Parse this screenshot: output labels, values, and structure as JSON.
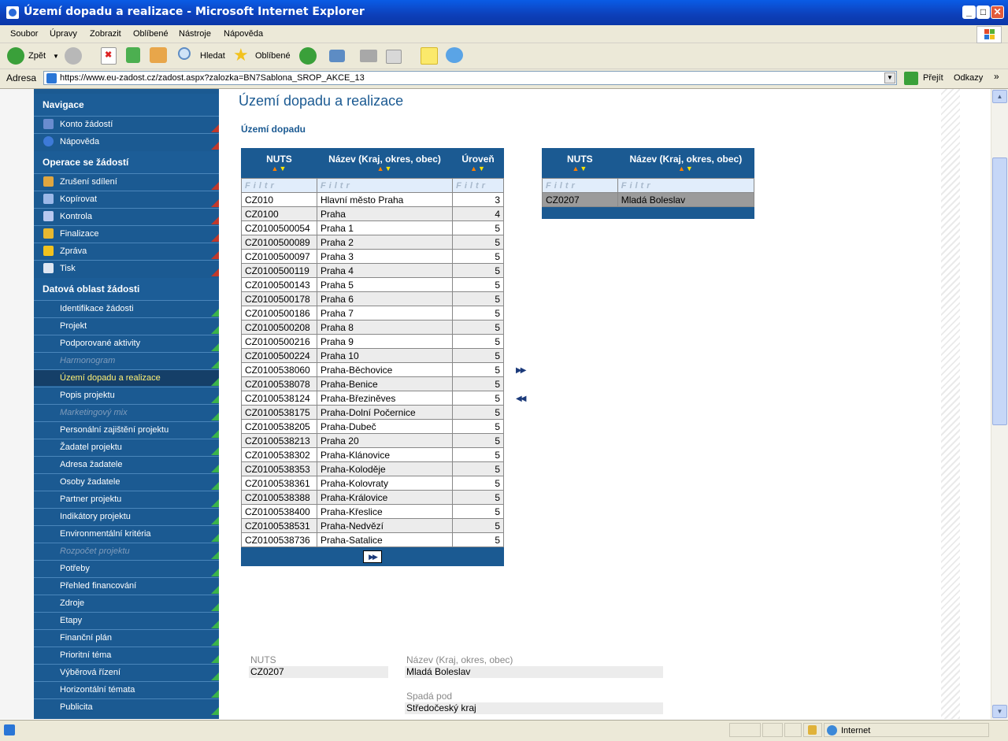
{
  "window": {
    "title": "Území dopadu a realizace - Microsoft Internet Explorer"
  },
  "menu": [
    "Soubor",
    "Úpravy",
    "Zobrazit",
    "Oblíbené",
    "Nástroje",
    "Nápověda"
  ],
  "toolbar": {
    "back": "Zpět",
    "search": "Hledat",
    "favorites": "Oblíbené"
  },
  "address": {
    "label": "Adresa",
    "url": "https://www.eu-zadost.cz/zadost.aspx?zalozka=BN7Sablona_SROP_AKCE_13",
    "go": "Přejít",
    "links": "Odkazy"
  },
  "nav": {
    "sections": [
      {
        "title": "Navigace",
        "items": [
          {
            "label": "Konto žádostí",
            "icon": "book-icon"
          },
          {
            "label": "Nápověda",
            "icon": "help-icon"
          }
        ]
      },
      {
        "title": "Operace se žádostí",
        "items": [
          {
            "label": "Zrušení sdílení",
            "icon": "users-icon"
          },
          {
            "label": "Kopírovat",
            "icon": "arrow-icon"
          },
          {
            "label": "Kontrola",
            "icon": "check-icon"
          },
          {
            "label": "Finalizace",
            "icon": "lock-icon"
          },
          {
            "label": "Zpráva",
            "icon": "mail-icon"
          },
          {
            "label": "Tisk",
            "icon": "print-icon"
          }
        ]
      },
      {
        "title": "Datová oblast žádosti",
        "items": [
          {
            "label": "Identifikace žádosti"
          },
          {
            "label": "Projekt"
          },
          {
            "label": "Podporované aktivity"
          },
          {
            "label": "Harmonogram",
            "disabled": true
          },
          {
            "label": "Území dopadu a realizace",
            "active": true
          },
          {
            "label": "Popis projektu"
          },
          {
            "label": "Marketingový mix",
            "disabled": true
          },
          {
            "label": "Personální zajištění projektu"
          },
          {
            "label": "Žadatel projektu"
          },
          {
            "label": "Adresa žadatele"
          },
          {
            "label": "Osoby žadatele"
          },
          {
            "label": "Partner projektu"
          },
          {
            "label": "Indikátory projektu"
          },
          {
            "label": "Environmentální kritéria"
          },
          {
            "label": "Rozpočet projektu",
            "disabled": true
          },
          {
            "label": "Potřeby"
          },
          {
            "label": "Přehled financování"
          },
          {
            "label": "Zdroje"
          },
          {
            "label": "Etapy"
          },
          {
            "label": "Finanční plán"
          },
          {
            "label": "Prioritní téma"
          },
          {
            "label": "Výběrová řízení"
          },
          {
            "label": "Horizontální témata"
          },
          {
            "label": "Publicita"
          }
        ]
      }
    ]
  },
  "page": {
    "title": "Území dopadu a realizace",
    "section": "Území dopadu"
  },
  "left_table": {
    "headers": [
      "NUTS",
      "Název (Kraj, okres, obec)",
      "Úroveň"
    ],
    "filter": [
      "Filtr",
      "Filtr",
      "Filtr"
    ],
    "rows": [
      [
        "CZ010",
        "Hlavní město Praha",
        "3"
      ],
      [
        "CZ0100",
        "Praha",
        "4"
      ],
      [
        "CZ0100500054",
        "Praha 1",
        "5"
      ],
      [
        "CZ0100500089",
        "Praha 2",
        "5"
      ],
      [
        "CZ0100500097",
        "Praha 3",
        "5"
      ],
      [
        "CZ0100500119",
        "Praha 4",
        "5"
      ],
      [
        "CZ0100500143",
        "Praha 5",
        "5"
      ],
      [
        "CZ0100500178",
        "Praha 6",
        "5"
      ],
      [
        "CZ0100500186",
        "Praha 7",
        "5"
      ],
      [
        "CZ0100500208",
        "Praha 8",
        "5"
      ],
      [
        "CZ0100500216",
        "Praha 9",
        "5"
      ],
      [
        "CZ0100500224",
        "Praha 10",
        "5"
      ],
      [
        "CZ0100538060",
        "Praha-Běchovice",
        "5"
      ],
      [
        "CZ0100538078",
        "Praha-Benice",
        "5"
      ],
      [
        "CZ0100538124",
        "Praha-Březiněves",
        "5"
      ],
      [
        "CZ0100538175",
        "Praha-Dolní Počernice",
        "5"
      ],
      [
        "CZ0100538205",
        "Praha-Dubeč",
        "5"
      ],
      [
        "CZ0100538213",
        "Praha 20",
        "5"
      ],
      [
        "CZ0100538302",
        "Praha-Klánovice",
        "5"
      ],
      [
        "CZ0100538353",
        "Praha-Koloděje",
        "5"
      ],
      [
        "CZ0100538361",
        "Praha-Kolovraty",
        "5"
      ],
      [
        "CZ0100538388",
        "Praha-Královice",
        "5"
      ],
      [
        "CZ0100538400",
        "Praha-Křeslice",
        "5"
      ],
      [
        "CZ0100538531",
        "Praha-Nedvězí",
        "5"
      ],
      [
        "CZ0100538736",
        "Praha-Satalice",
        "5"
      ]
    ]
  },
  "right_table": {
    "headers": [
      "NUTS",
      "Název (Kraj, okres, obec)"
    ],
    "filter": [
      "Filtr",
      "Filtr"
    ],
    "rows": [
      [
        "CZ0207",
        "Mladá Boleslav"
      ]
    ]
  },
  "controls": {
    "add_all": "▶▶",
    "remove_all": "◀◀",
    "next_page": "▶▶"
  },
  "details": {
    "nuts_label": "NUTS",
    "nuts_value": "CZ0207",
    "name_label": "Název (Kraj, okres, obec)",
    "name_value": "Mladá Boleslav",
    "parent_label": "Spadá pod",
    "parent_value": "Středočeský kraj"
  },
  "status": {
    "zone": "Internet"
  },
  "colors": {
    "nav_bg": "#1b5a92",
    "active_text": "#fff176",
    "title_blue": "#1b5a92"
  }
}
